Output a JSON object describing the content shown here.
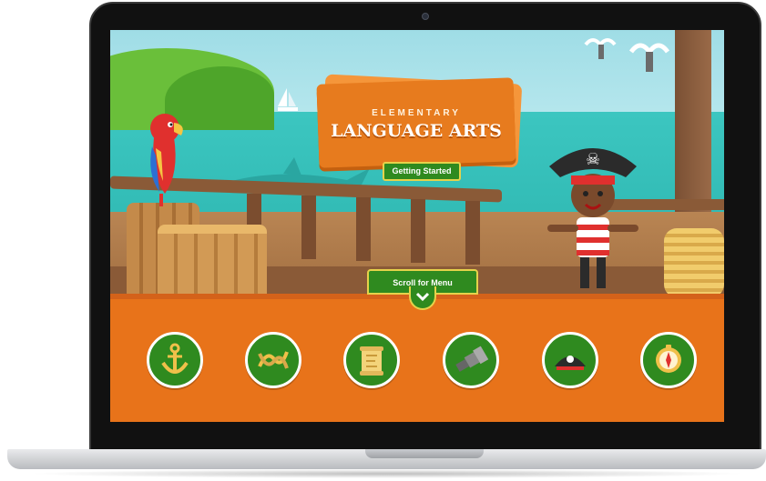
{
  "app": {
    "subtitle": "ELEMENTARY",
    "title": "LANGUAGE ARTS",
    "getting_started_label": "Getting Started",
    "scroll_label": "Scroll for Menu"
  },
  "menu": {
    "items": [
      {
        "icon": "anchor-icon"
      },
      {
        "icon": "rope-knot-icon"
      },
      {
        "icon": "scroll-map-icon"
      },
      {
        "icon": "spyglass-icon"
      },
      {
        "icon": "pirate-hat-icon"
      },
      {
        "icon": "compass-icon"
      }
    ]
  },
  "colors": {
    "accent_orange": "#e8731a",
    "button_green": "#2f8a1f",
    "button_border": "#e6d24a",
    "sea": "#3cc6c0"
  }
}
